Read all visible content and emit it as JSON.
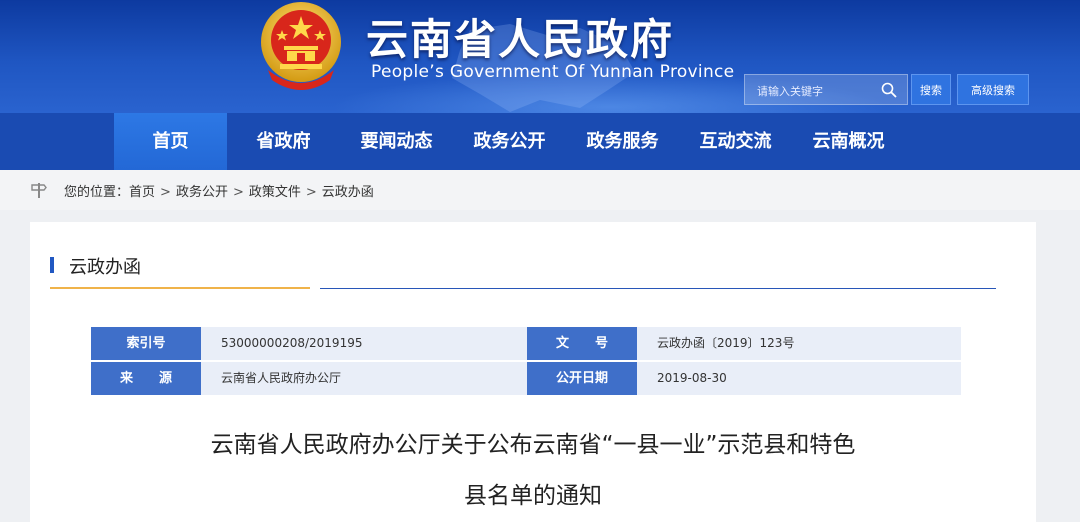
{
  "header": {
    "site_title": "云南省人民政府",
    "site_subtitle": "People’s Government Of Yunnan Province",
    "search_placeholder": "请输入关键字",
    "search_button": "搜索",
    "advanced_search_button": "高级搜索"
  },
  "nav": {
    "items": [
      {
        "label": "首页",
        "active": true
      },
      {
        "label": "省政府"
      },
      {
        "label": "要闻动态"
      },
      {
        "label": "政务公开"
      },
      {
        "label": "政务服务"
      },
      {
        "label": "互动交流"
      },
      {
        "label": "云南概况"
      }
    ]
  },
  "breadcrumb": {
    "prefix": "您的位置：",
    "items": [
      "首页",
      "政务公开",
      "政策文件",
      "云政办函"
    ],
    "separator": ">"
  },
  "section": {
    "title": "云政办函"
  },
  "meta": {
    "index_label": "索引号",
    "index_value": "53000000208/2019195",
    "docno_label": "文　　号",
    "docno_value": "云政办函〔2019〕123号",
    "source_label": "来　　源",
    "source_value": "云南省人民政府办公厅",
    "date_label": "公开日期",
    "date_value": "2019-08-30"
  },
  "document": {
    "title_line1": "云南省人民政府办公厅关于公布云南省“一县一业”示范县和特色",
    "title_line2": "县名单的通知"
  },
  "colors": {
    "header_blue": "#1f56c2",
    "nav_blue": "#1a4bb2",
    "nav_active": "#2d78e5",
    "label_blue": "#3f6fc9",
    "gold_line": "#f0b34a"
  }
}
